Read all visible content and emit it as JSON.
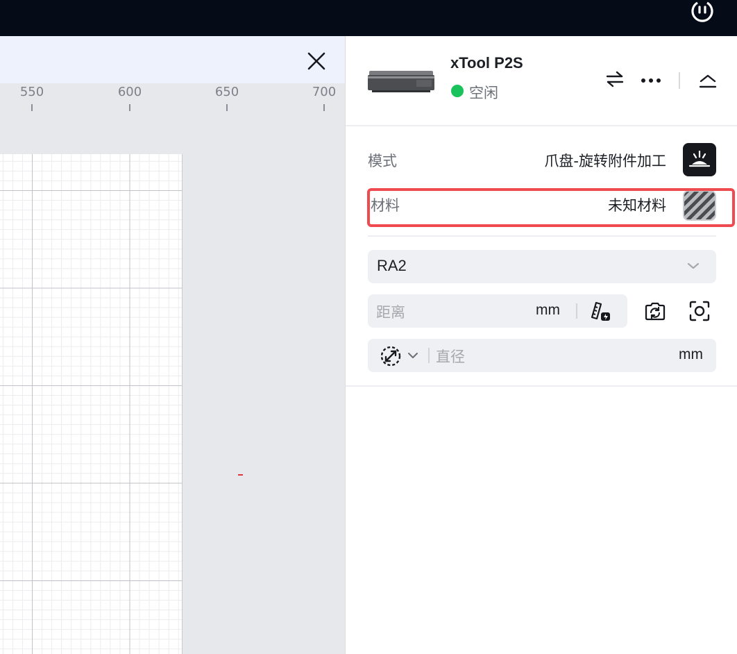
{
  "topbar": {
    "power_icon": "power-icon"
  },
  "canvas": {
    "close_icon": "close-icon",
    "ruler": {
      "ticks": [
        "550",
        "600",
        "650",
        "700"
      ]
    }
  },
  "device": {
    "name": "xTool P2S",
    "status": "空闲",
    "status_color": "#19c25b",
    "icons": [
      "swap-icon",
      "more-icon",
      "collapse-icon"
    ]
  },
  "settings": {
    "mode": {
      "label": "模式",
      "value": "爪盘-旋转附件加工",
      "icon": "laser-mode-icon"
    },
    "material": {
      "label": "材料",
      "value": "未知材料",
      "icon": "material-swatch-icon"
    },
    "highlight_color": "#ef4a4f",
    "rotary_select": {
      "value": "RA2"
    },
    "distance": {
      "placeholder": "距离",
      "unit": "mm"
    },
    "diameter": {
      "placeholder": "直径",
      "unit": "mm"
    }
  }
}
